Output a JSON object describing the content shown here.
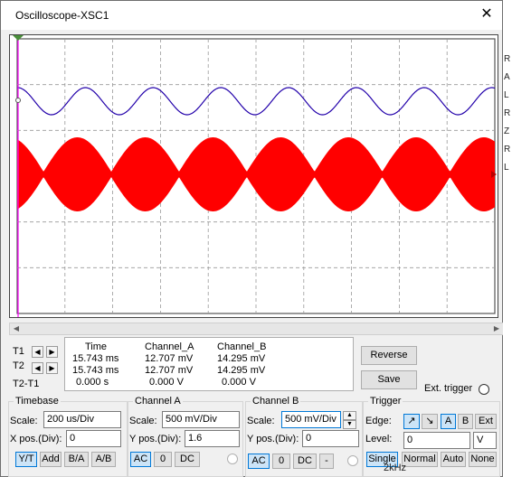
{
  "window": {
    "title": "Oscilloscope-XSC1",
    "close_glyph": "✕"
  },
  "background_fragments": [
    "R",
    "A",
    "L",
    "R",
    "Z",
    "R",
    "L",
    "2kHz"
  ],
  "screen": {
    "trace_a_color": "#ff0000",
    "trace_b_color": "#2200aa",
    "cursor_color": "#ff00ff",
    "grid_divisions": {
      "x": 10,
      "y": 6
    }
  },
  "measure": {
    "t1_label": "T1",
    "t2_label": "T2",
    "t2t1_label": "T2-T1",
    "headers": [
      "Time",
      "Channel_A",
      "Channel_B"
    ],
    "rows": [
      [
        "15.743 ms",
        "12.707 mV",
        "14.295 mV"
      ],
      [
        "15.743 ms",
        "12.707 mV",
        "14.295 mV"
      ],
      [
        "0.000 s",
        "0.000 V",
        "0.000 V"
      ]
    ]
  },
  "buttons": {
    "reverse": "Reverse",
    "save": "Save",
    "ext_trigger": "Ext. trigger"
  },
  "timebase": {
    "title": "Timebase",
    "scale_label": "Scale:",
    "scale_value": "200 us/Div",
    "xpos_label": "X pos.(Div):",
    "xpos_value": "0",
    "modes": [
      "Y/T",
      "Add",
      "B/A",
      "A/B"
    ]
  },
  "channel_a": {
    "title": "Channel A",
    "scale_label": "Scale:",
    "scale_value": "500 mV/Div",
    "ypos_label": "Y pos.(Div):",
    "ypos_value": "1.6",
    "coupling": [
      "AC",
      "0",
      "DC"
    ]
  },
  "channel_b": {
    "title": "Channel B",
    "scale_label": "Scale:",
    "scale_value": "500 mV/Div",
    "ypos_label": "Y pos.(Div):",
    "ypos_value": "0",
    "coupling": [
      "AC",
      "0",
      "DC",
      "-"
    ]
  },
  "trigger": {
    "title": "Trigger",
    "edge_label": "Edge:",
    "edge_sources": [
      "A",
      "B",
      "Ext"
    ],
    "level_label": "Level:",
    "level_value": "0",
    "level_unit": "V",
    "modes": [
      "Single",
      "Normal",
      "Auto",
      "None"
    ]
  }
}
